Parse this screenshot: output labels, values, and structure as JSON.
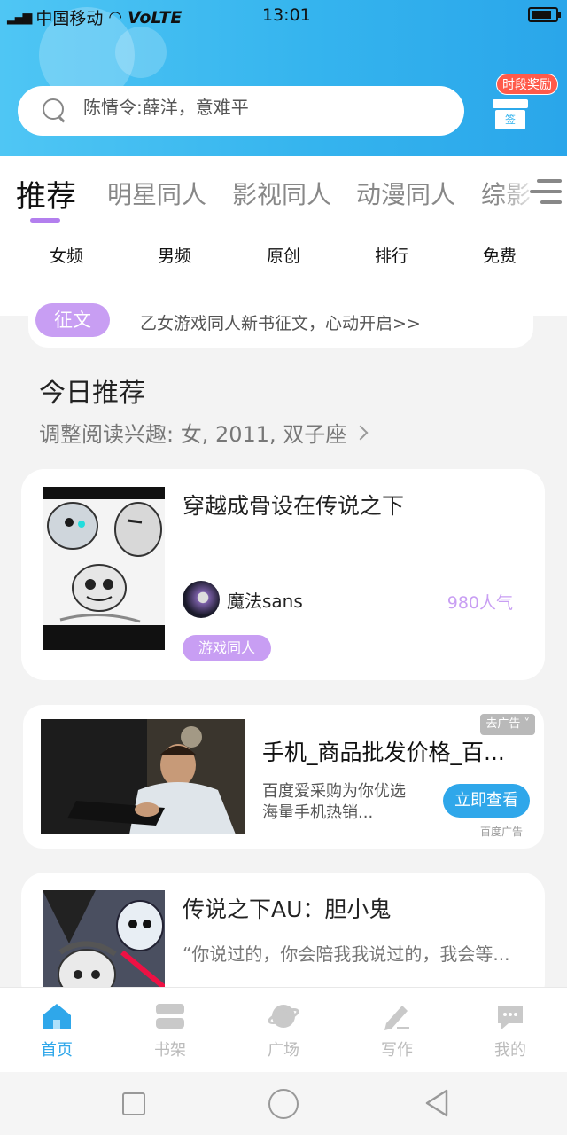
{
  "status_bar": {
    "carrier": "中国移动",
    "network": "VoLTE",
    "time": "13:01",
    "battery_level": 0.85
  },
  "header": {
    "search_placeholder": "陈情令:薛洋，意难平",
    "reward_badge": "时段奖励",
    "gift_label": "签"
  },
  "tabs": [
    "推荐",
    "明星同人",
    "影视同人",
    "动漫同人",
    "综影"
  ],
  "active_tab": "推荐",
  "subcategories": [
    "女频",
    "男频",
    "原创",
    "排行",
    "免费"
  ],
  "notice": {
    "tag": "征文",
    "text": "乙女游戏同人新书征文，心动开启>>"
  },
  "today": {
    "title": "今日推荐",
    "subtitle": "调整阅读兴趣: 女, 2011, 双子座"
  },
  "books": [
    {
      "title": "穿越成骨设在传说之下",
      "author": "魔法sans",
      "popularity": "980人气",
      "tag": "游戏同人"
    },
    {
      "title": "传说之下AU：胆小鬼",
      "desc": "“你说过的，你会陪我我说过的，我会等..."
    }
  ],
  "ad": {
    "title": "手机_商品批发价格_百...",
    "desc": "百度爱采购为你优选海量手机热销...",
    "button": "立即查看",
    "close_label": "去广告",
    "source": "百度广告"
  },
  "bottom_nav": [
    {
      "label": "首页",
      "icon": "home-icon",
      "active": true
    },
    {
      "label": "书架",
      "icon": "bookshelf-icon",
      "active": false
    },
    {
      "label": "广场",
      "icon": "planet-icon",
      "active": false
    },
    {
      "label": "写作",
      "icon": "pen-icon",
      "active": false
    },
    {
      "label": "我的",
      "icon": "chat-bubble-icon",
      "active": false
    }
  ],
  "colors": {
    "header_blue": "#35b4ee",
    "accent_purple": "#c89ef3",
    "active_blue": "#2fa7ea"
  }
}
